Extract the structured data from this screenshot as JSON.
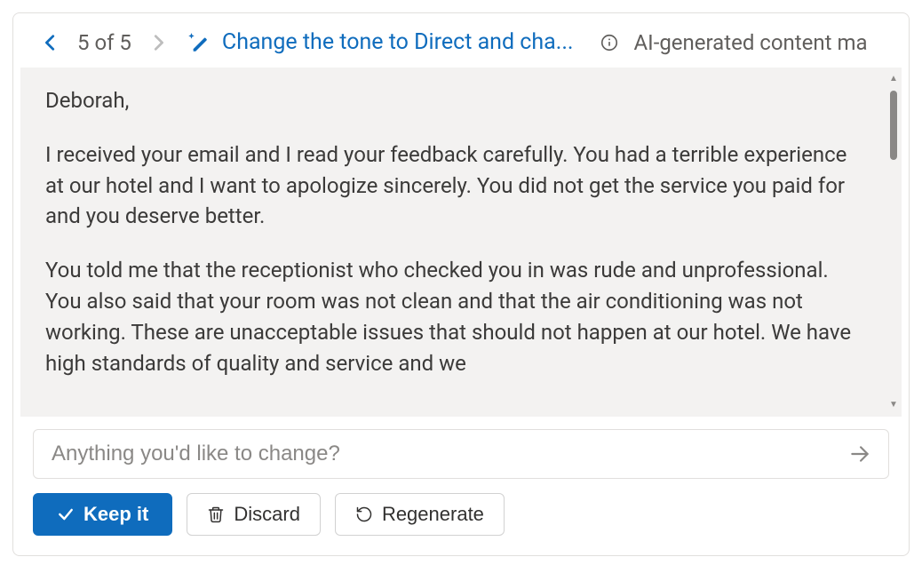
{
  "header": {
    "position_current": 5,
    "position_total": 5,
    "counter_text": "5 of 5",
    "prompt_text": "Change the tone to Direct and cha...",
    "info_text": "AI-generated content ma"
  },
  "content": {
    "paragraphs": [
      "Deborah,",
      "I received your email and I read your feedback carefully. You had a terrible experience at our hotel and I want to apologize sincerely. You did not get the service you paid for and you deserve better.",
      "You told me that the receptionist who checked you in was rude and unprofessional. You also said that your room was not clean and that the air conditioning was not working. These are unacceptable issues that should not happen at our hotel. We have high standards of quality and service and we"
    ]
  },
  "input": {
    "placeholder": "Anything you'd like to change?"
  },
  "actions": {
    "keep_label": "Keep it",
    "discard_label": "Discard",
    "regenerate_label": "Regenerate"
  },
  "colors": {
    "accent": "#0f6cbd",
    "muted_text": "#605e5c",
    "panel_bg": "#f3f2f1"
  }
}
